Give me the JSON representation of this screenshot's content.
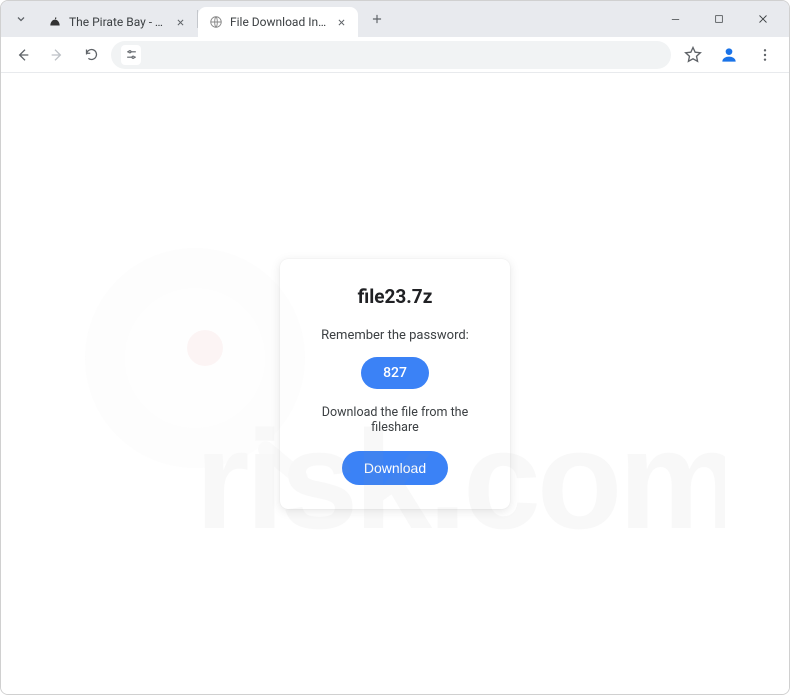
{
  "browser": {
    "tabs": [
      {
        "title": "The Pirate Bay - The galaxy's m…",
        "active": false
      },
      {
        "title": "File Download Instructions for f…",
        "active": true
      }
    ]
  },
  "page": {
    "card": {
      "filename": "file23.7z",
      "remember_text": "Remember the password:",
      "password": "827",
      "instruction": "Download the file from the fileshare",
      "download_label": "Download"
    }
  },
  "watermark": {
    "text": "pcrisk.com"
  }
}
